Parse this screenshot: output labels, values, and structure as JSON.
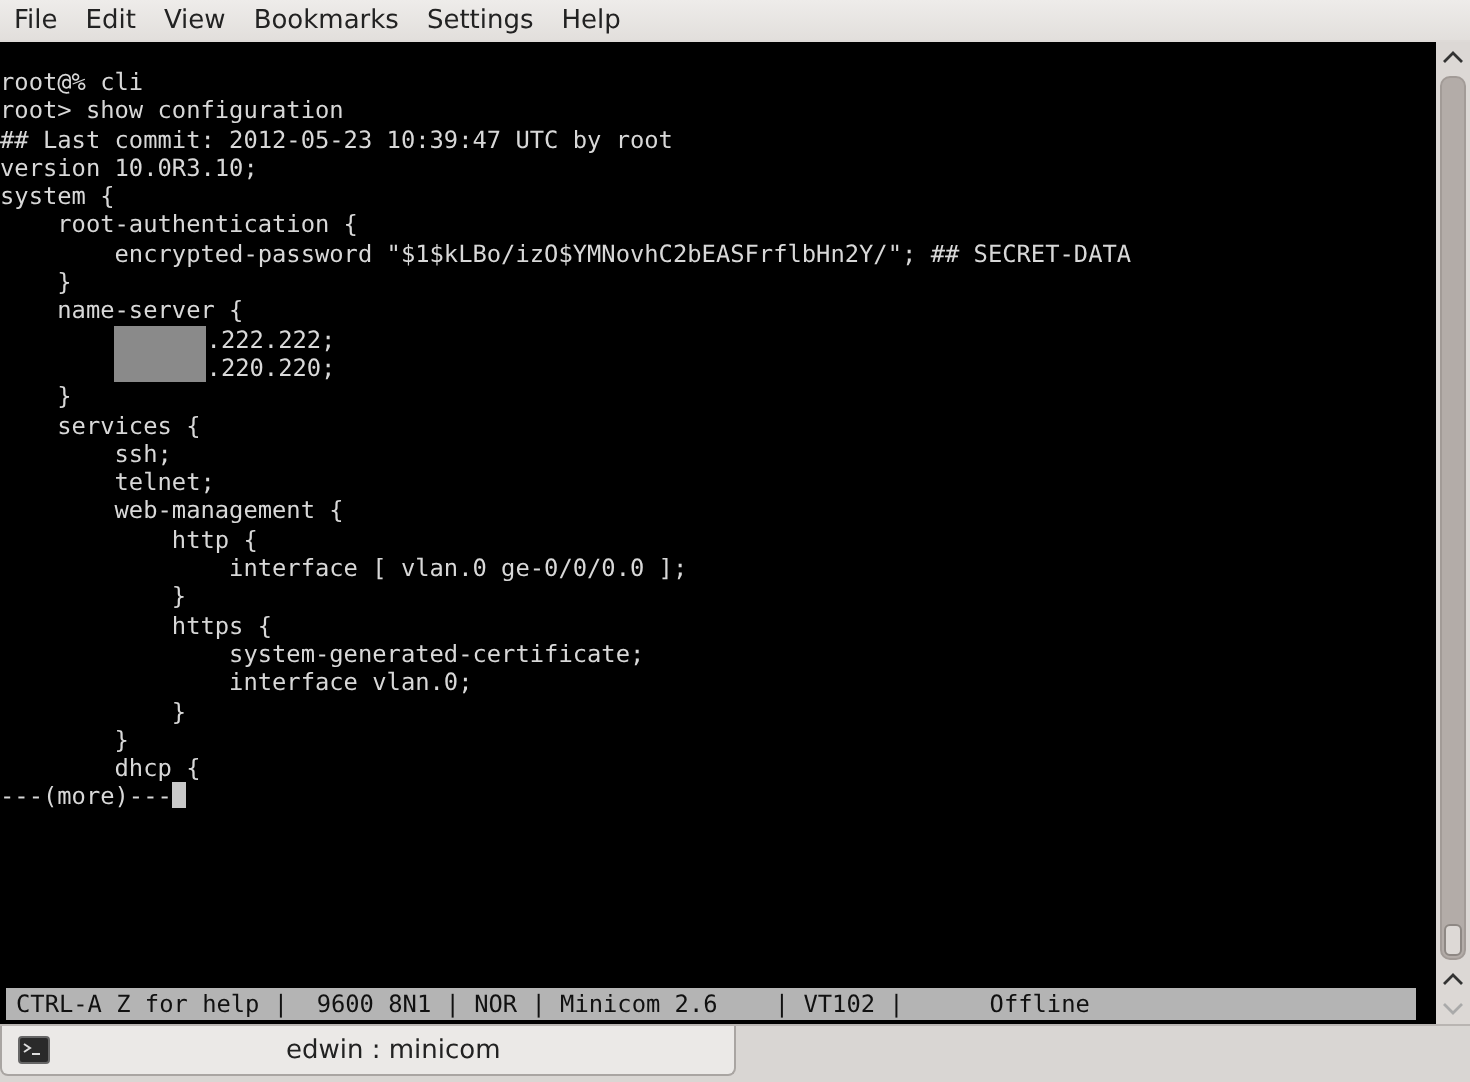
{
  "menu": [
    "File",
    "Edit",
    "View",
    "Bookmarks",
    "Settings",
    "Help"
  ],
  "terminal": {
    "lines": [
      {
        "text": "root@% cli"
      },
      {
        "text": "root> show configuration"
      },
      {
        "text": "## Last commit: 2012-05-23 10:39:47 UTC by root"
      },
      {
        "text": "version 10.0R3.10;"
      },
      {
        "text": "system {"
      },
      {
        "text": "    root-authentication {"
      },
      {
        "text": "        encrypted-password \"$1$kLBo/izO$YMNovhC2bEASFrflbHn2Y/\"; ## SECRET-DATA"
      },
      {
        "text": "    }"
      },
      {
        "text": "    name-server {"
      },
      {
        "text": "        .222.222;",
        "redacted": true
      },
      {
        "text": "        .220.220;",
        "redacted": true
      },
      {
        "text": "    }"
      },
      {
        "text": "    services {"
      },
      {
        "text": "        ssh;"
      },
      {
        "text": "        telnet;"
      },
      {
        "text": "        web-management {"
      },
      {
        "text": "            http {"
      },
      {
        "text": "                interface [ vlan.0 ge-0/0/0.0 ];"
      },
      {
        "text": "            }"
      },
      {
        "text": "            https {"
      },
      {
        "text": "                system-generated-certificate;"
      },
      {
        "text": "                interface vlan.0;"
      },
      {
        "text": "            }"
      },
      {
        "text": "        }"
      },
      {
        "text": "        dhcp {"
      },
      {
        "text": "---(more)---",
        "cursor": true
      }
    ],
    "status_bar": "CTRL-A Z for help |  9600 8N1 | NOR | Minicom 2.6    | VT102 |      Offline"
  },
  "tabs": [
    {
      "label": "edwin : minicom",
      "selected": true
    }
  ]
}
